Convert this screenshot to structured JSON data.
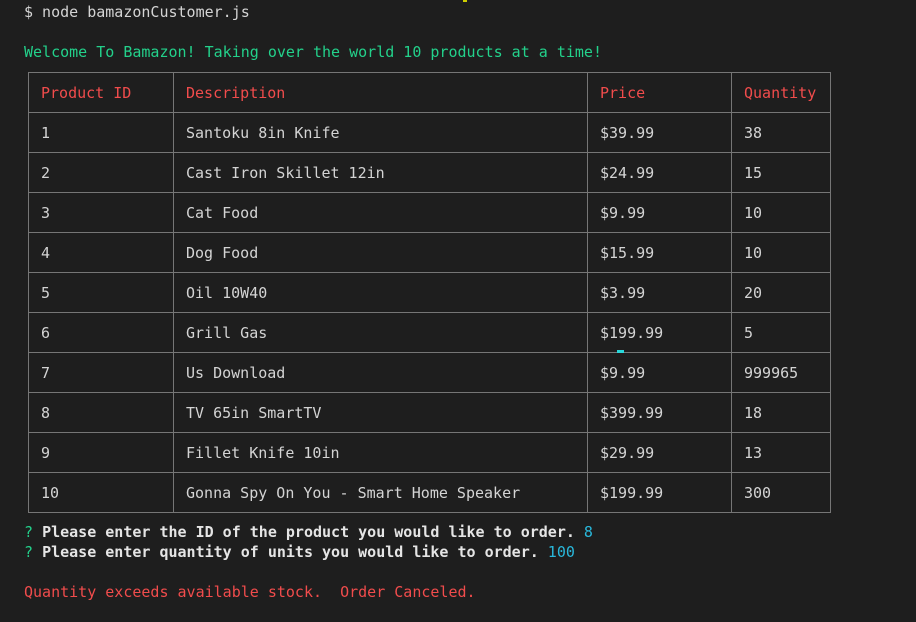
{
  "terminal": {
    "command_line": "$ node bamazonCustomer.js",
    "welcome": "Welcome To Bamazon! Taking over the world 10 products at a time!",
    "table": {
      "headers": [
        "Product ID",
        "Description",
        "Price",
        "Quantity"
      ],
      "rows": [
        [
          "1",
          "Santoku 8in Knife",
          "$39.99",
          "38"
        ],
        [
          "2",
          "Cast Iron Skillet 12in",
          "$24.99",
          "15"
        ],
        [
          "3",
          "Cat Food",
          "$9.99",
          "10"
        ],
        [
          "4",
          "Dog Food",
          "$15.99",
          "10"
        ],
        [
          "5",
          "Oil 10W40",
          "$3.99",
          "20"
        ],
        [
          "6",
          "Grill Gas",
          "$199.99",
          "5"
        ],
        [
          "7",
          "Us Download",
          "$9.99",
          "999965"
        ],
        [
          "8",
          "TV 65in SmartTV",
          "$399.99",
          "18"
        ],
        [
          "9",
          "Fillet Knife 10in",
          "$29.99",
          "13"
        ],
        [
          "10",
          "Gonna Spy On You - Smart Home Speaker",
          "$199.99",
          "300"
        ]
      ]
    },
    "prompts": [
      {
        "mark": "?",
        "question": "Please enter the ID of the product you would like to order.",
        "answer": "8"
      },
      {
        "mark": "?",
        "question": "Please enter quantity of units you would like to order.",
        "answer": "100"
      }
    ],
    "error": "Quantity exceeds available stock.  Order Canceled."
  },
  "colors": {
    "background": "#1e1e1e",
    "green": "#23d18b",
    "red": "#f14c4c",
    "cyan": "#29b8db",
    "border": "#767676"
  }
}
